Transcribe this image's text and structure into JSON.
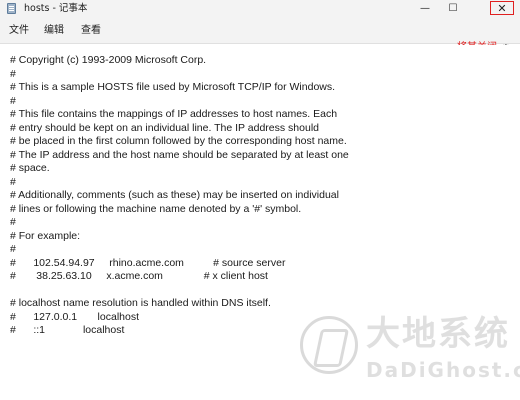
{
  "window": {
    "title": "hosts - 记事本",
    "minimize_glyph": "—",
    "maximize_glyph": "☐",
    "close_glyph": "✕"
  },
  "menu": {
    "items": [
      "文件",
      "编辑",
      "查看"
    ]
  },
  "annotation": {
    "text": "将其关闭",
    "color": "#e02020"
  },
  "icons": {
    "app": "notepad-icon",
    "settings": "gear-icon"
  },
  "editor": {
    "content": "# Copyright (c) 1993-2009 Microsoft Corp.\n#\n# This is a sample HOSTS file used by Microsoft TCP/IP for Windows.\n#\n# This file contains the mappings of IP addresses to host names. Each\n# entry should be kept on an individual line. The IP address should\n# be placed in the first column followed by the corresponding host name.\n# The IP address and the host name should be separated by at least one\n# space.\n#\n# Additionally, comments (such as these) may be inserted on individual\n# lines or following the machine name denoted by a '#' symbol.\n#\n# For example:\n#\n#      102.54.94.97     rhino.acme.com          # source server\n#       38.25.63.10     x.acme.com              # x client host\n\n# localhost name resolution is handled within DNS itself.\n#\t127.0.0.1       localhost\n#\t::1             localhost"
  },
  "watermark": {
    "cn": "大地系统",
    "en": "DaDiGhost.com"
  }
}
